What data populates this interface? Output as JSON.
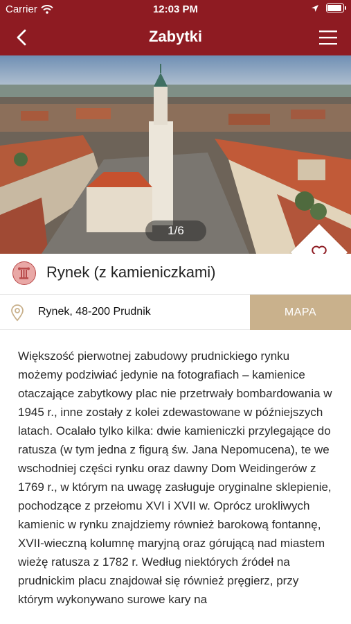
{
  "status_bar": {
    "carrier": "Carrier",
    "time": "12:03 PM",
    "battery_level": 0.9
  },
  "navbar": {
    "title": "Zabytki",
    "back_icon": "chevron-left-icon",
    "menu_icon": "hamburger-menu-icon"
  },
  "gallery": {
    "counter": "1/6",
    "favorite_icon": "heart-outline-icon"
  },
  "place": {
    "category_icon": "column-icon",
    "title": "Rynek (z kamieniczkami)"
  },
  "address": {
    "pin_icon": "location-pin-icon",
    "text": "Rynek, 48-200 Prudnik",
    "map_button": "MAPA"
  },
  "description": "Większość pierwotnej zabudowy prudnickiego rynku możemy podziwiać jedynie na fotografiach – kamienice otaczające zabytkowy plac nie przetrwały bombardowania w 1945 r., inne zostały z kolei zdewastowane w późniejszych latach. Ocalało tylko kilka: dwie kamieniczki przylegające do ratusza (w tym jedna z figurą św. Jana Nepomucena), te we wschodniej części rynku oraz dawny Dom Weidingerów z 1769 r., w którym na uwagę zasługuje oryginalne sklepienie, pochodzące z przełomu XVI i XVII w. Oprócz urokliwych kamienic w rynku znajdziemy również barokową fontannę, XVII-wieczną kolumnę maryjną oraz górującą nad miastem wieżę ratusza z 1782 r. Według niektórych źródeł na prudnickim placu znajdował się również pręgierz, przy którym wykonywano surowe kary na",
  "colors": {
    "primary": "#8e1b22",
    "map_button": "#c9b18c",
    "category_icon_bg": "#e9a8a6"
  }
}
